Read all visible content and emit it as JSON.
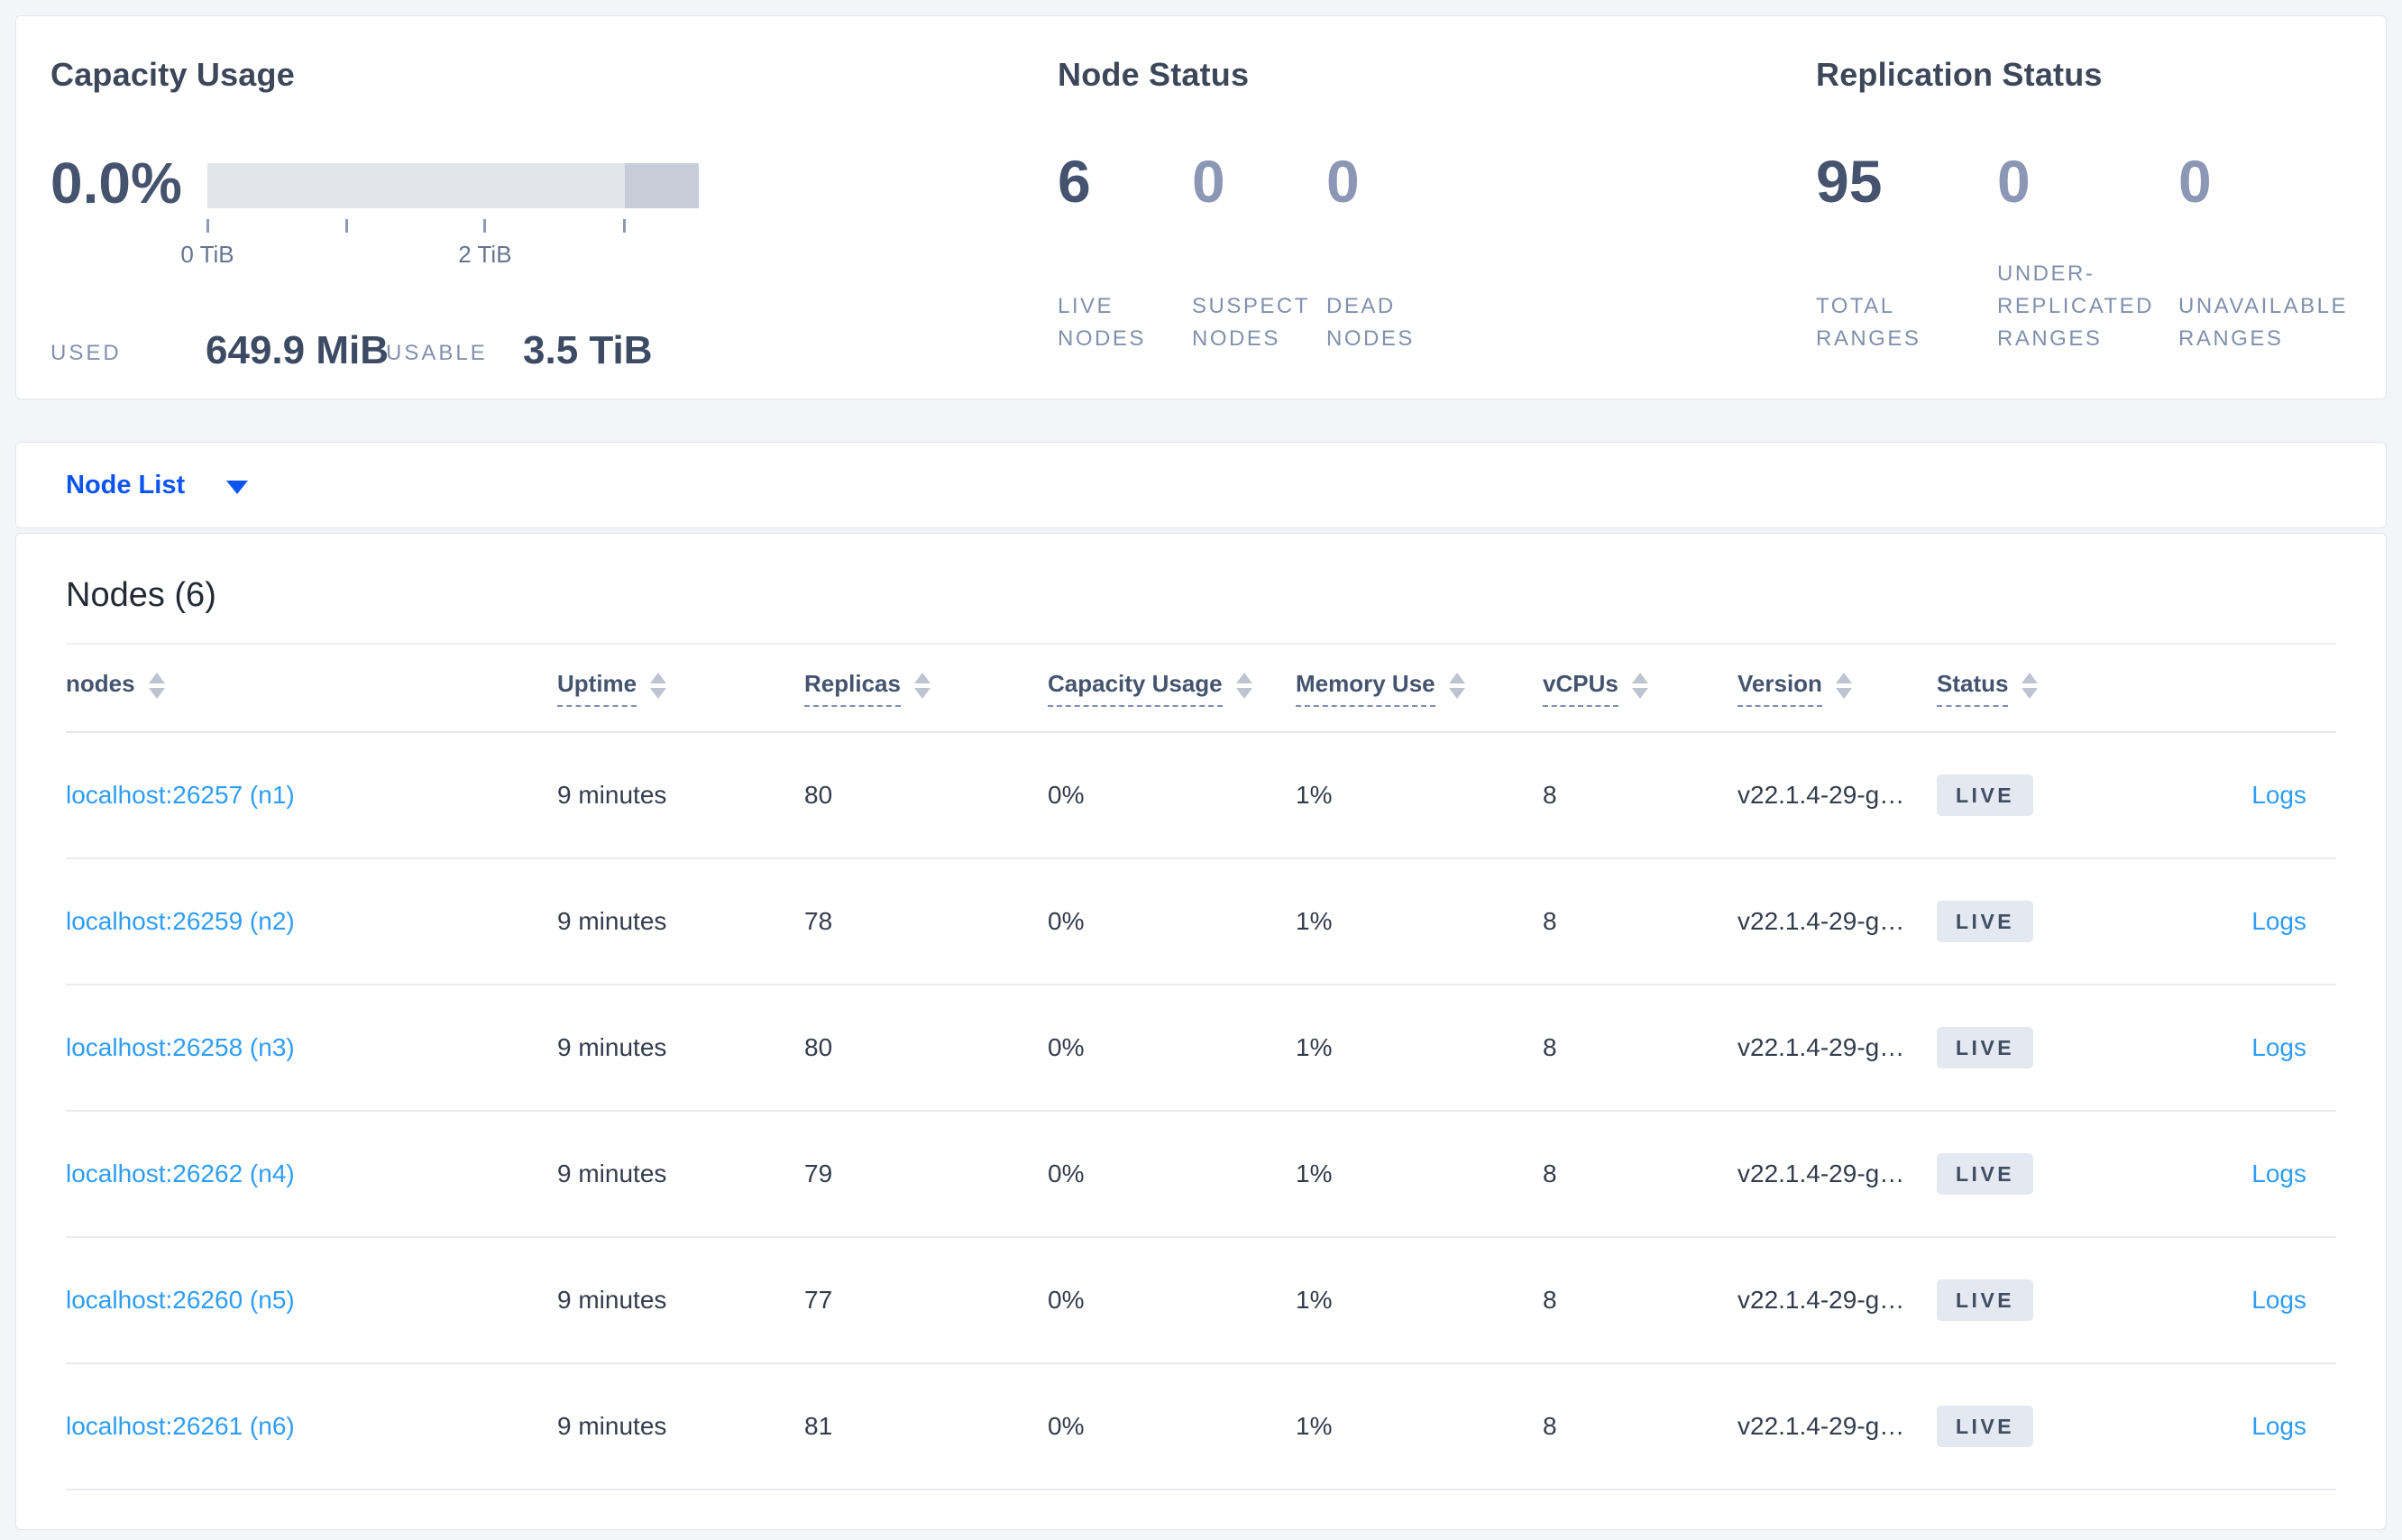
{
  "summary": {
    "capacity": {
      "title": "Capacity Usage",
      "percent": "0.0%",
      "used_label": "USED",
      "used_value": "649.9 MiB",
      "usable_label": "USABLE",
      "usable_value": "3.5 TiB",
      "axis_ticks": [
        {
          "pos": 0,
          "label": "0 TiB"
        },
        {
          "pos": 28.3,
          "label": ""
        },
        {
          "pos": 56.5,
          "label": "2 TiB"
        },
        {
          "pos": 84.9,
          "label": ""
        }
      ],
      "bar": {
        "track_color": "#e2e4ec",
        "segment_color": "#c7ccd9",
        "segment_start_pct": 84.9
      }
    },
    "node_status": {
      "title": "Node Status",
      "items": [
        {
          "value": "6",
          "label_lines": [
            "LIVE",
            "NODES"
          ],
          "emph": true
        },
        {
          "value": "0",
          "label_lines": [
            "SUSPECT",
            "NODES"
          ],
          "emph": false
        },
        {
          "value": "0",
          "label_lines": [
            "DEAD",
            "NODES"
          ],
          "emph": false
        }
      ]
    },
    "replication": {
      "title": "Replication Status",
      "items": [
        {
          "value": "95",
          "label_lines": [
            "TOTAL",
            "RANGES"
          ],
          "emph": true
        },
        {
          "value": "0",
          "label_lines": [
            "UNDER-",
            "REPLICATED",
            "RANGES"
          ],
          "emph": false
        },
        {
          "value": "0",
          "label_lines": [
            "UNAVAILABLE",
            "RANGES"
          ],
          "emph": false
        }
      ]
    }
  },
  "view_selector": {
    "label": "Node List"
  },
  "table": {
    "heading": "Nodes (6)",
    "columns": [
      {
        "label": "nodes",
        "sortable": true,
        "underline": false
      },
      {
        "label": "Uptime",
        "sortable": true,
        "underline": true
      },
      {
        "label": "Replicas",
        "sortable": true,
        "underline": true
      },
      {
        "label": "Capacity Usage",
        "sortable": true,
        "underline": true
      },
      {
        "label": "Memory Use",
        "sortable": true,
        "underline": true
      },
      {
        "label": "vCPUs",
        "sortable": true,
        "underline": true
      },
      {
        "label": "Version",
        "sortable": true,
        "underline": true
      },
      {
        "label": "Status",
        "sortable": true,
        "underline": true
      },
      {
        "label": "",
        "sortable": false,
        "underline": false
      }
    ],
    "rows": [
      {
        "node": "localhost:26257 (n1)",
        "uptime": "9 minutes",
        "replicas": "80",
        "capacity": "0%",
        "memory": "1%",
        "vcpus": "8",
        "version": "v22.1.4-29-g…",
        "status": "LIVE",
        "logs": "Logs"
      },
      {
        "node": "localhost:26259 (n2)",
        "uptime": "9 minutes",
        "replicas": "78",
        "capacity": "0%",
        "memory": "1%",
        "vcpus": "8",
        "version": "v22.1.4-29-g…",
        "status": "LIVE",
        "logs": "Logs"
      },
      {
        "node": "localhost:26258 (n3)",
        "uptime": "9 minutes",
        "replicas": "80",
        "capacity": "0%",
        "memory": "1%",
        "vcpus": "8",
        "version": "v22.1.4-29-g…",
        "status": "LIVE",
        "logs": "Logs"
      },
      {
        "node": "localhost:26262 (n4)",
        "uptime": "9 minutes",
        "replicas": "79",
        "capacity": "0%",
        "memory": "1%",
        "vcpus": "8",
        "version": "v22.1.4-29-g…",
        "status": "LIVE",
        "logs": "Logs"
      },
      {
        "node": "localhost:26260 (n5)",
        "uptime": "9 minutes",
        "replicas": "77",
        "capacity": "0%",
        "memory": "1%",
        "vcpus": "8",
        "version": "v22.1.4-29-g…",
        "status": "LIVE",
        "logs": "Logs"
      },
      {
        "node": "localhost:26261 (n6)",
        "uptime": "9 minutes",
        "replicas": "81",
        "capacity": "0%",
        "memory": "1%",
        "vcpus": "8",
        "version": "v22.1.4-29-g…",
        "status": "LIVE",
        "logs": "Logs"
      }
    ]
  },
  "colors": {
    "accent_blue": "#0c54f2",
    "link_blue": "#2f9df6",
    "status_live_bg": "#e4e8f0",
    "status_live_text": "#404d63",
    "bar_track": "#e2e4ec",
    "bar_segment": "#c7ccd9"
  }
}
